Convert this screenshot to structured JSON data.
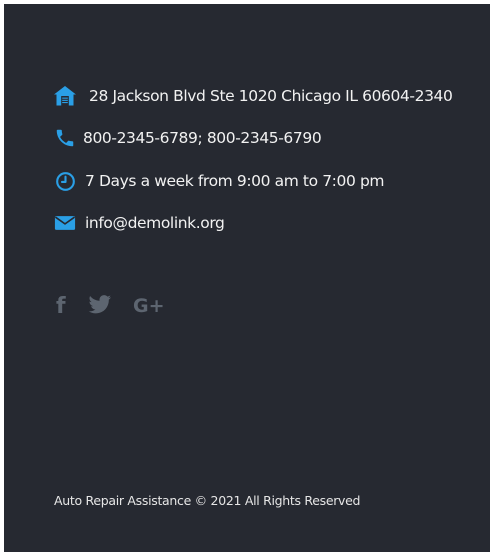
{
  "colors": {
    "panel_background": "#262931",
    "accent": "#2a9fe6",
    "social_icon": "#5d6570",
    "text": "#f2f2f2"
  },
  "contact": {
    "address": {
      "icon": "home-icon",
      "text": "28 Jackson Blvd Ste 1020 Chicago IL 60604-2340"
    },
    "phone": {
      "icon": "phone-icon",
      "text": "800-2345-6789; 800-2345-6790"
    },
    "hours": {
      "icon": "clock-icon",
      "text": "7 Days a week from 9:00 am to 7:00 pm"
    },
    "email": {
      "icon": "envelope-icon",
      "text": "info@demolink.org"
    }
  },
  "social": [
    {
      "icon": "facebook-icon",
      "glyph": "f"
    },
    {
      "icon": "twitter-icon"
    },
    {
      "icon": "google-plus-icon",
      "glyph": "G+"
    }
  ],
  "footer": {
    "copyright": "Auto Repair Assistance © 2021 All Rights Reserved"
  }
}
